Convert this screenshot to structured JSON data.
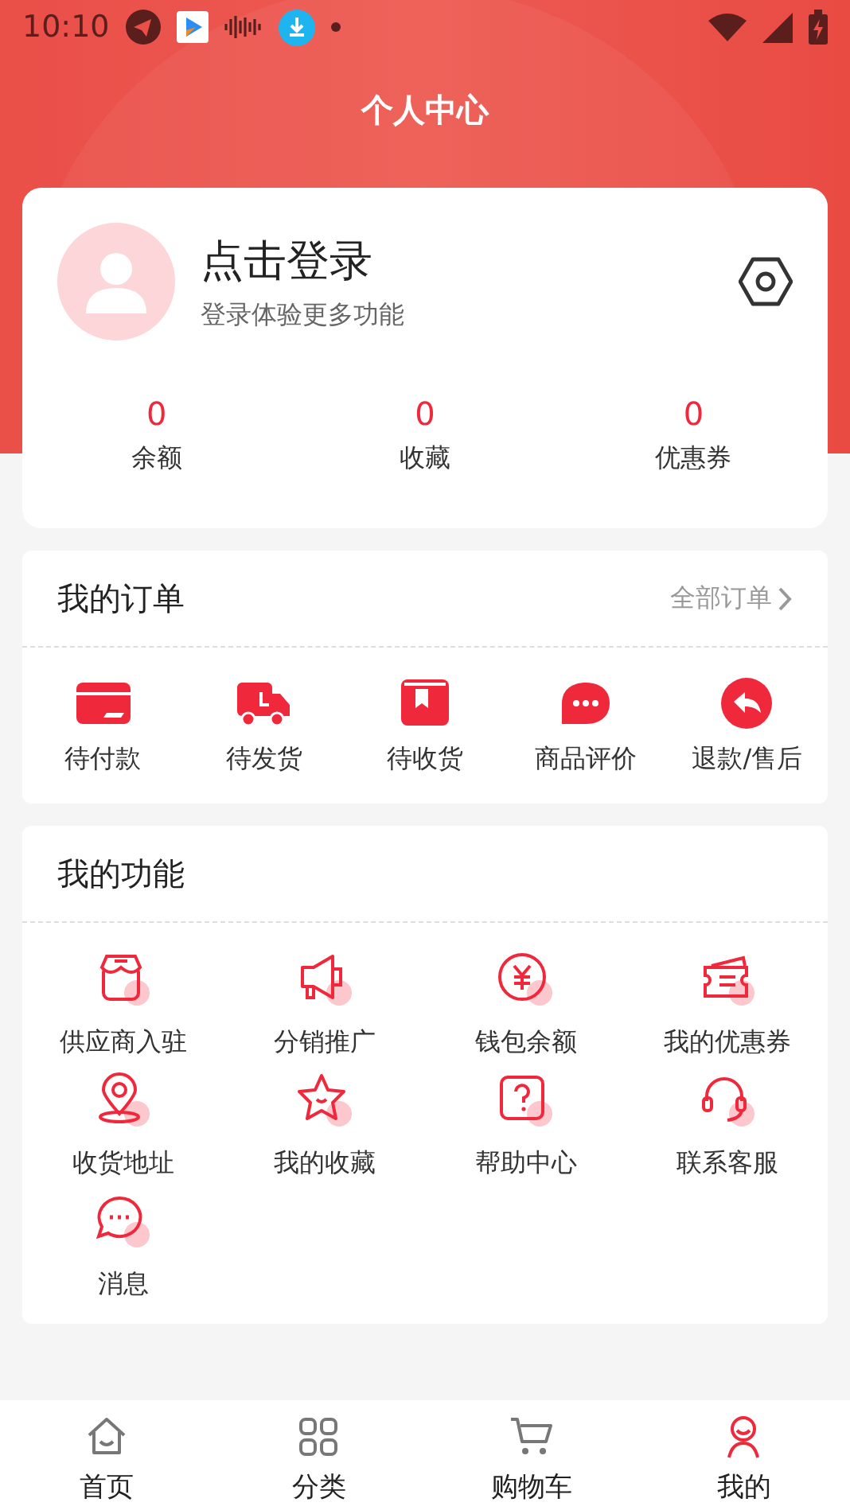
{
  "status_bar": {
    "time": "10:10"
  },
  "header": {
    "title": "个人中心"
  },
  "profile": {
    "name": "点击登录",
    "subtitle": "登录体验更多功能"
  },
  "stats": [
    {
      "value": "0",
      "label": "余额"
    },
    {
      "value": "0",
      "label": "收藏"
    },
    {
      "value": "0",
      "label": "优惠券"
    }
  ],
  "orders": {
    "title": "我的订单",
    "link": "全部订单",
    "items": [
      {
        "label": "待付款"
      },
      {
        "label": "待发货"
      },
      {
        "label": "待收货"
      },
      {
        "label": "商品评价"
      },
      {
        "label": "退款/售后"
      }
    ]
  },
  "functions": {
    "title": "我的功能",
    "items": [
      {
        "label": "供应商入驻"
      },
      {
        "label": "分销推广"
      },
      {
        "label": "钱包余额"
      },
      {
        "label": "我的优惠券"
      },
      {
        "label": "收货地址"
      },
      {
        "label": "我的收藏"
      },
      {
        "label": "帮助中心"
      },
      {
        "label": "联系客服"
      },
      {
        "label": "消息"
      }
    ]
  },
  "bottom_nav": [
    {
      "label": "首页",
      "selected": false
    },
    {
      "label": "分类",
      "selected": false
    },
    {
      "label": "购物车",
      "selected": false
    },
    {
      "label": "我的",
      "selected": true
    }
  ]
}
